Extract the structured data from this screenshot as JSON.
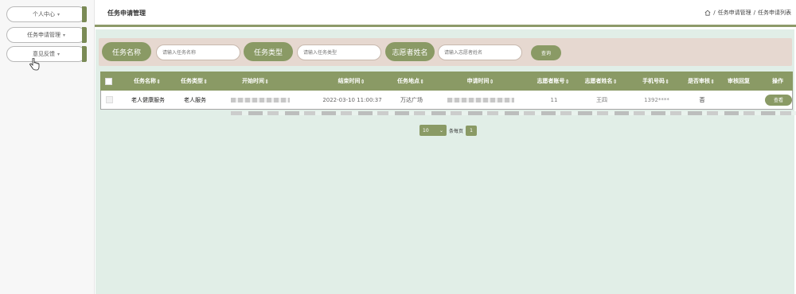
{
  "sidebar": {
    "items": [
      {
        "label": "个人中心"
      },
      {
        "label": "任务申请管理"
      },
      {
        "label": "意见反馈"
      }
    ]
  },
  "header": {
    "title": "任务申请管理",
    "breadcrumb": [
      "任务申请管理",
      "任务申请列表"
    ]
  },
  "search": {
    "fields": [
      {
        "label": "任务名称",
        "placeholder": "请输入任务名称"
      },
      {
        "label": "任务类型",
        "placeholder": "请输入任务类型"
      },
      {
        "label": "志愿者姓名",
        "placeholder": "请输入志愿者姓名"
      }
    ],
    "button_label": "查询"
  },
  "table": {
    "columns": [
      "任务名称",
      "任务类型",
      "开始时间",
      "结束时间",
      "任务地点",
      "申请时间",
      "志愿者账号",
      "志愿者姓名",
      "手机号码",
      "是否审核",
      "审核回复",
      "操作"
    ],
    "rows": [
      {
        "task_name": "老人健康服务",
        "task_type": "老人服务",
        "end_time": "2022-03-10 11:00:37",
        "location": "万达广场",
        "account": "11",
        "volunteer_name": "王四",
        "phone": "1392****",
        "audited": "否",
        "reply": "",
        "action_label": "查看"
      }
    ]
  },
  "pagination": {
    "page_size": "10",
    "page_size_suffix": "条每页",
    "current_page": "1"
  },
  "colors": {
    "accent": "#8a9a65",
    "panel_bg": "#e1eee7",
    "search_bg": "#e6d8d0"
  }
}
